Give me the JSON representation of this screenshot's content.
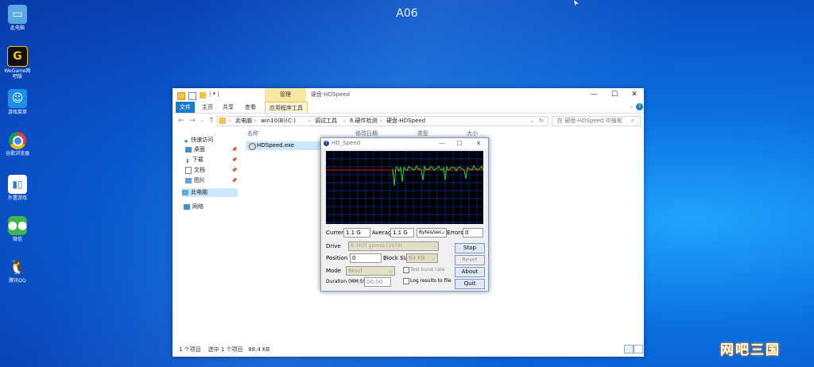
{
  "desktop": {
    "top_title": "A06",
    "icons": [
      {
        "label": "此电脑",
        "icon": "computer-icon",
        "color": "#5aa9e6"
      },
      {
        "label": "WeGame网吧版",
        "icon": "wegame-icon",
        "color": "#111111"
      },
      {
        "label": "游戏菜单",
        "icon": "game-menu-icon",
        "color": "#1d8fe8"
      },
      {
        "label": "谷歌浏览器",
        "icon": "chrome-icon",
        "color": "#ffffff"
      },
      {
        "label": "外置游戏",
        "icon": "external-games-icon",
        "color": "#2e7bd6"
      },
      {
        "label": "微信",
        "icon": "wechat-icon",
        "color": "#3fb54a"
      },
      {
        "label": "腾讯QQ",
        "icon": "qq-icon",
        "color": "#111111"
      }
    ],
    "watermark": "网吧三国"
  },
  "explorer": {
    "ribbon_context_tab": "管理",
    "window_title": "硬盘-HDSpeed",
    "tabs": [
      "文件",
      "主页",
      "共享",
      "查看",
      "应用程序工具"
    ],
    "address_crumbs": [
      "此电脑",
      "win10(B)(C:)",
      "调试工具",
      "6.硬件检测",
      "硬盘-HDSpeed"
    ],
    "search_placeholder": "在 硬盘-HDSpeed 中搜索",
    "nav": {
      "quick_access": "快速访问",
      "items": [
        "桌面",
        "下载",
        "文档",
        "图片"
      ],
      "this_pc": "此电脑",
      "network": "网络"
    },
    "columns": [
      "名称",
      "修改日期",
      "类型",
      "大小"
    ],
    "file": {
      "name": "HDSpeed.exe",
      "size_fragment": "KB"
    },
    "status": {
      "count": "1 个项目",
      "selected": "选中 1 个项目",
      "size": "88.4 KB"
    }
  },
  "hdspeed": {
    "title": "HD_Speed",
    "current_label": "Current",
    "current_value": "1.1 G",
    "average_label": "Average",
    "average_value": "1.1 G",
    "unit_value": "Bytes/sec",
    "errors_label": "Errors",
    "errors_value": "0",
    "drive_label": "Drive",
    "drive_value": "B: HOT games (1978)",
    "position_label": "Position %",
    "position_value": "0",
    "block_label": "Block Size",
    "block_value": "64 KB",
    "mode_label": "Mode",
    "mode_value": "Read",
    "burst_label": "Test burst rate",
    "duration_label": "Duration (MM:SS)",
    "duration_value": "00:00",
    "log_label": "Log results to file",
    "buttons": {
      "stop": "Stop",
      "reset": "Reset",
      "about": "About",
      "quit": "Quit"
    },
    "graph_colors": {
      "grid": "#0b2f9a",
      "average": "#d21a1a",
      "speed": "#2ed12e"
    }
  }
}
